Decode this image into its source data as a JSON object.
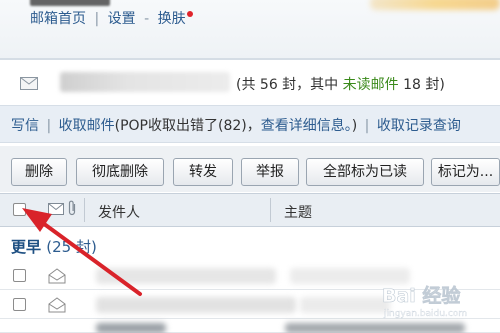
{
  "top_nav": {
    "home": "邮箱首页",
    "sep": "|",
    "settings": "设置",
    "dash": "-",
    "skin": "换肤"
  },
  "summary": {
    "prefix": "(共 56 封，其中 ",
    "unread": "未读邮件",
    "suffix": " 18 封)"
  },
  "actions": {
    "compose": "写信",
    "sep": "|",
    "fetch": "收取邮件",
    "pop_error": "(POP收取出错了(82)，",
    "view_detail": "查看详细信息。",
    "close_paren": ")",
    "fetch_query": "收取记录查询"
  },
  "toolbar": {
    "delete": "删除",
    "delete_permanently": "彻底删除",
    "forward": "转发",
    "report": "举报",
    "mark_all_read": "全部标为已读",
    "mark_as": "标记为..."
  },
  "columns": {
    "sender": "发件人",
    "subject": "主题"
  },
  "group": {
    "label": "更早",
    "count": "(25 封)"
  },
  "watermark": {
    "text": "Bai 经验",
    "url": "jingyan.baidu.com"
  },
  "colors": {
    "link": "#2d5c8f",
    "unread_green": "#3a8a1a",
    "arrow_red": "#d9232a"
  }
}
